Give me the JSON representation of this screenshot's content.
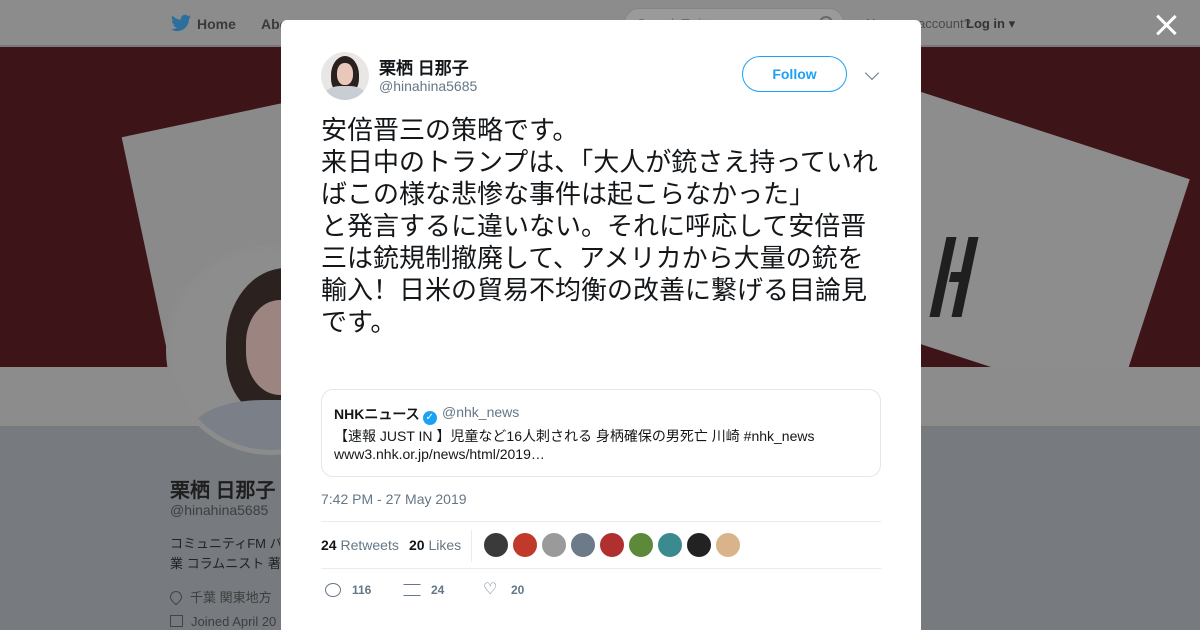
{
  "nav": {
    "home": "Home",
    "about": "Abo",
    "search_placeholder": "Search Twitter",
    "have_account": "Have an account?",
    "login": "Log in"
  },
  "profile_bg": {
    "name": "栗栖 日那子",
    "handle": "@hinahina5685",
    "bio_line1": "コミュニティFM パ",
    "bio_line2": "業 コラムニスト 著",
    "location": "千葉 関東地方",
    "joined": "Joined April 20"
  },
  "tweet": {
    "author_name": "栗栖 日那子",
    "author_handle": "@hinahina5685",
    "follow_label": "Follow",
    "text_lines": [
      "安倍晋三の策略です。",
      "来日中のトランプは、「大人が銃さえ持っていればこの様な悲惨な事件は起こらなかった」",
      "と発言するに違いない。それに呼応して安倍晋三は銃規制撤廃して、アメリカから大量の銃を輸入！日米の貿易不均衡の改善に繋げる目論見です。"
    ],
    "quote": {
      "name": "NHKニュース",
      "handle": "@nhk_news",
      "text": "【速報 JUST IN 】児童など16人刺される 身柄確保の男死亡 川崎 #nhk_news",
      "url": "www3.nhk.or.jp/news/html/2019…"
    },
    "timestamp": "7:42 PM - 27 May 2019",
    "retweets_count": "24",
    "retweets_label": "Retweets",
    "likes_count": "20",
    "likes_label": "Likes",
    "actions": {
      "replies": "116",
      "retweets": "24",
      "likes": "20"
    }
  },
  "colors": {
    "accent": "#1da1f2",
    "text_secondary": "#657786",
    "liker_avatars": [
      "#3a3a3a",
      "#c0392b",
      "#9a9a9a",
      "#6c7a89",
      "#b03030",
      "#5d8a3a",
      "#3a8a8f",
      "#222222",
      "#d9b48a"
    ]
  }
}
